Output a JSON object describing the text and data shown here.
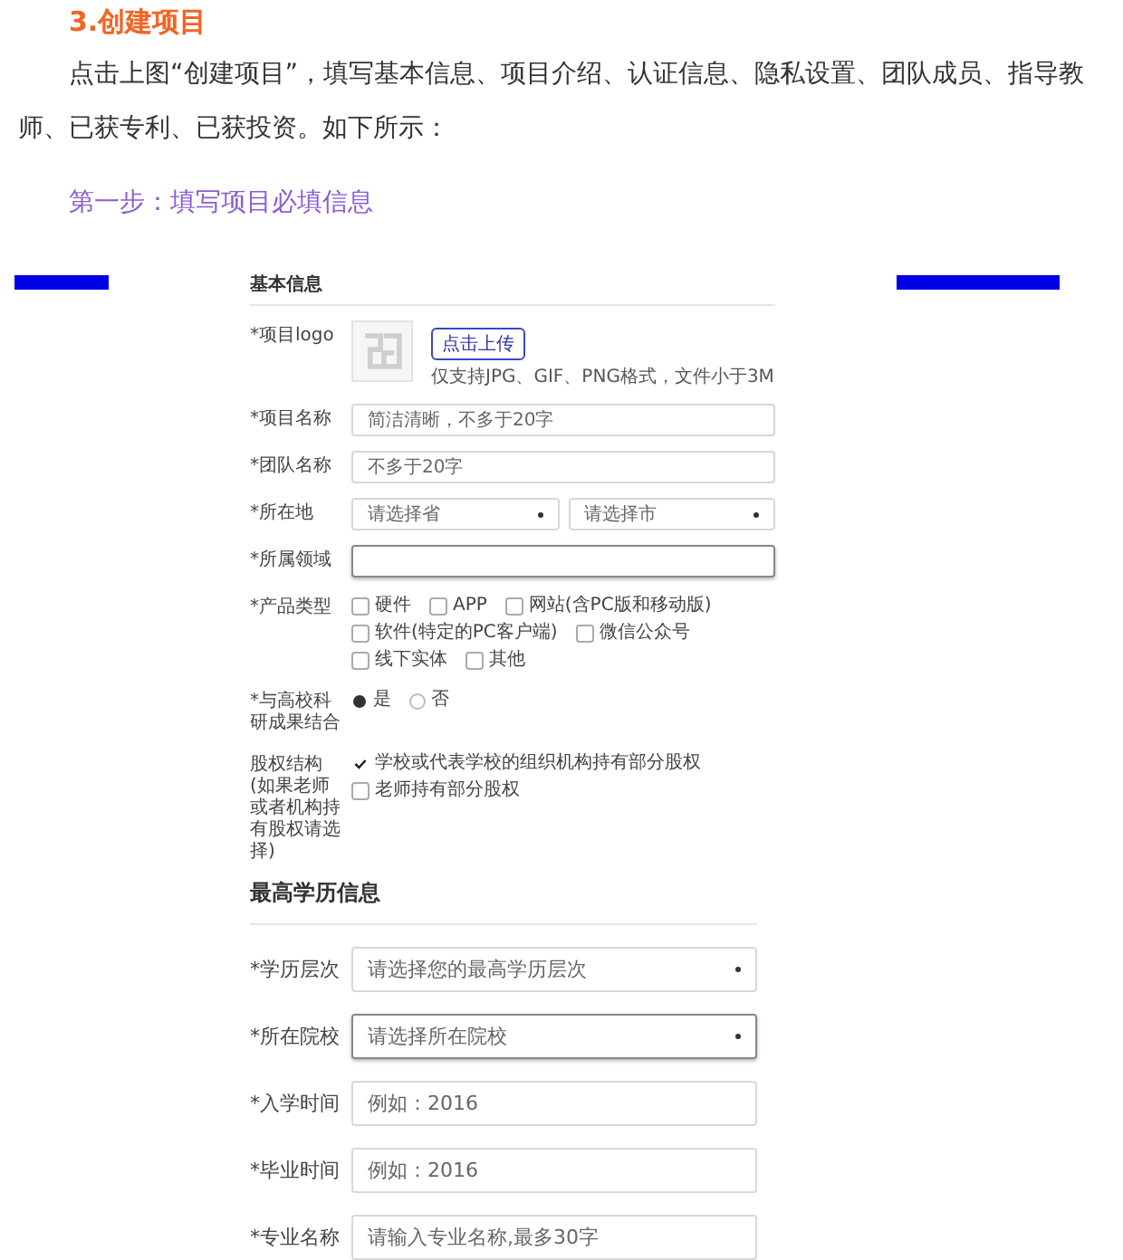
{
  "article": {
    "heading": "3.创建项目",
    "paragraph": "点击上图“创建项目”，填写基本信息、项目介绍、认证信息、隐私设置、团队成员、指导教师、已获专利、已获投资。如下所示：",
    "step": "第一步：填写项目必填信息"
  },
  "form": {
    "sections": [
      {
        "title": "基本信息",
        "fields": [
          {
            "kind": "logo",
            "label": "*项目logo",
            "button": "点击上传",
            "hint": "仅支持JPG、GIF、PNG格式，文件小于3M"
          },
          {
            "kind": "input",
            "label": "*项目名称",
            "placeholder": "简洁清晰，不多于20字"
          },
          {
            "kind": "input",
            "label": "*团队名称",
            "placeholder": "不多于20字"
          },
          {
            "kind": "selects",
            "label": "*所在地",
            "selects": [
              {
                "text": "请选择省",
                "focused": false
              },
              {
                "text": "请选择市",
                "focused": false
              }
            ]
          },
          {
            "kind": "input",
            "label": "*所属领域",
            "focused": true
          },
          {
            "kind": "checks",
            "label": "*产品类型",
            "options": [
              {
                "text": "硬件",
                "checked": false
              },
              {
                "text": "APP",
                "checked": false
              },
              {
                "text": "网站(含PC版和移动版)",
                "checked": false
              },
              {
                "text": "软件(特定的PC客户端)",
                "checked": false
              },
              {
                "text": "微信公众号",
                "checked": false
              },
              {
                "text": "线下实体",
                "checked": false
              },
              {
                "text": "其他",
                "checked": false
              }
            ]
          },
          {
            "kind": "radios",
            "label": "*与高校科研成果结合",
            "options": [
              {
                "text": "是",
                "selected": true
              },
              {
                "text": "否",
                "selected": false
              }
            ]
          },
          {
            "kind": "checks",
            "label": "股权结构(如果老师或者机构持有股权请选择)",
            "options": [
              {
                "text": "学校或代表学校的组织机构持有部分股权",
                "checked": true
              },
              {
                "text": "老师持有部分股权",
                "checked": false
              }
            ]
          }
        ]
      },
      {
        "title": "最高学历信息",
        "fields": [
          {
            "kind": "selects",
            "label": "*学历层次",
            "selects": [
              {
                "text": "请选择您的最高学历层次",
                "focused": false
              }
            ]
          },
          {
            "kind": "selects",
            "label": "*所在院校",
            "selects": [
              {
                "text": "请选择所在院校",
                "focused": true
              }
            ]
          },
          {
            "kind": "input",
            "label": "*入学时间",
            "placeholder": "例如：2016"
          },
          {
            "kind": "input",
            "label": "*毕业时间",
            "placeholder": "例如：2016"
          },
          {
            "kind": "input",
            "label": "*专业名称",
            "placeholder": "请输入专业名称,最多30字"
          }
        ]
      }
    ]
  }
}
